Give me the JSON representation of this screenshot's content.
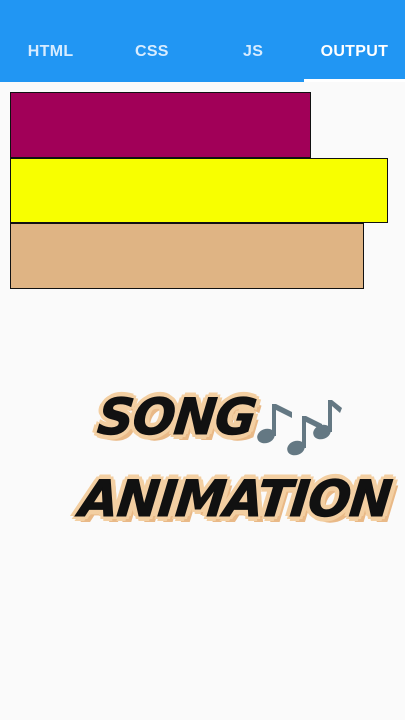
{
  "tabs": [
    {
      "label": "HTML"
    },
    {
      "label": "CSS"
    },
    {
      "label": "JS"
    },
    {
      "label": "OUTPUT",
      "active": true
    }
  ],
  "colors": {
    "topbar": "#2196f3",
    "bar_1": "#a10058",
    "bar_2": "#f8ff00",
    "bar_3": "#dfb484",
    "notes": "#647883"
  },
  "overlay": {
    "line1": "SONG",
    "line2": "ANIMATION",
    "notes_icon": "musical-notes-icon"
  }
}
